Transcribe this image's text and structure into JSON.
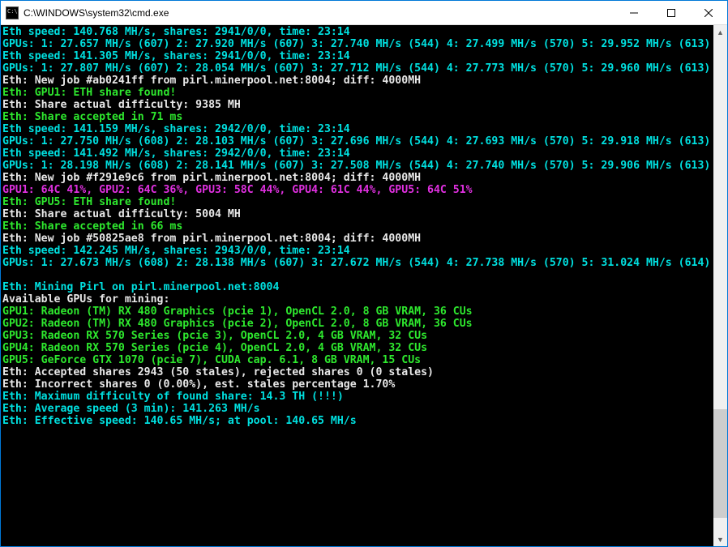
{
  "window": {
    "title": "C:\\WINDOWS\\system32\\cmd.exe"
  },
  "l": {
    "0": {
      "cls": "c-cyan",
      "t": "Eth speed: 140.768 MH/s, shares: 2941/0/0, time: 23:14"
    },
    "1": {
      "cls": "c-cyan",
      "t": "GPUs: 1: 27.657 MH/s (607) 2: 27.920 MH/s (607) 3: 27.740 MH/s (544) 4: 27.499 MH/s (570) 5: 29.952 MH/s (613)"
    },
    "2": {
      "cls": "c-cyan",
      "t": "Eth speed: 141.305 MH/s, shares: 2941/0/0, time: 23:14"
    },
    "3": {
      "cls": "c-cyan",
      "t": "GPUs: 1: 27.807 MH/s (607) 2: 28.054 MH/s (607) 3: 27.712 MH/s (544) 4: 27.773 MH/s (570) 5: 29.960 MH/s (613)"
    },
    "4": {
      "cls": "c-white",
      "t": "Eth: New job #ab0241ff from pirl.minerpool.net:8004; diff: 4000MH"
    },
    "5": {
      "cls": "c-green",
      "t": "Eth: GPU1: ETH share found!"
    },
    "6": {
      "cls": "c-white",
      "t": "Eth: Share actual difficulty: 9385 MH"
    },
    "7": {
      "cls": "c-green",
      "t": "Eth: Share accepted in 71 ms"
    },
    "8": {
      "cls": "c-cyan",
      "t": "Eth speed: 141.159 MH/s, shares: 2942/0/0, time: 23:14"
    },
    "9": {
      "cls": "c-cyan",
      "t": "GPUs: 1: 27.750 MH/s (608) 2: 28.103 MH/s (607) 3: 27.696 MH/s (544) 4: 27.693 MH/s (570) 5: 29.918 MH/s (613)"
    },
    "10": {
      "cls": "c-cyan",
      "t": "Eth speed: 141.492 MH/s, shares: 2942/0/0, time: 23:14"
    },
    "11": {
      "cls": "c-cyan",
      "t": "GPUs: 1: 28.198 MH/s (608) 2: 28.141 MH/s (607) 3: 27.508 MH/s (544) 4: 27.740 MH/s (570) 5: 29.906 MH/s (613)"
    },
    "12": {
      "cls": "c-white",
      "t": "Eth: New job #f291e9c6 from pirl.minerpool.net:8004; diff: 4000MH"
    },
    "13": {
      "cls": "c-mag",
      "t": "GPU1: 64C 41%, GPU2: 64C 36%, GPU3: 58C 44%, GPU4: 61C 44%, GPU5: 64C 51%"
    },
    "14": {
      "cls": "c-green",
      "t": "Eth: GPU5: ETH share found!"
    },
    "15": {
      "cls": "c-white",
      "t": "Eth: Share actual difficulty: 5004 MH"
    },
    "16": {
      "cls": "c-green",
      "t": "Eth: Share accepted in 66 ms"
    },
    "17": {
      "cls": "c-white",
      "t": "Eth: New job #50825ae8 from pirl.minerpool.net:8004; diff: 4000MH"
    },
    "18": {
      "cls": "c-cyan",
      "t": "Eth speed: 142.245 MH/s, shares: 2943/0/0, time: 23:14"
    },
    "19": {
      "cls": "c-cyan",
      "t": "GPUs: 1: 27.673 MH/s (608) 2: 28.138 MH/s (607) 3: 27.672 MH/s (544) 4: 27.738 MH/s (570) 5: 31.024 MH/s (614)"
    },
    "20": {
      "cls": "c-cyan",
      "t": ""
    },
    "21": {
      "cls": "c-cyan",
      "t": "Eth: Mining Pirl on pirl.minerpool.net:8004"
    },
    "22": {
      "cls": "c-white",
      "t": "Available GPUs for mining:"
    },
    "23": {
      "cls": "c-green",
      "t": "GPU1: Radeon (TM) RX 480 Graphics (pcie 1), OpenCL 2.0, 8 GB VRAM, 36 CUs"
    },
    "24": {
      "cls": "c-green",
      "t": "GPU2: Radeon (TM) RX 480 Graphics (pcie 2), OpenCL 2.0, 8 GB VRAM, 36 CUs"
    },
    "25": {
      "cls": "c-green",
      "t": "GPU3: Radeon RX 570 Series (pcie 3), OpenCL 2.0, 4 GB VRAM, 32 CUs"
    },
    "26": {
      "cls": "c-green",
      "t": "GPU4: Radeon RX 570 Series (pcie 4), OpenCL 2.0, 4 GB VRAM, 32 CUs"
    },
    "27": {
      "cls": "c-green",
      "t": "GPU5: GeForce GTX 1070 (pcie 7), CUDA cap. 6.1, 8 GB VRAM, 15 CUs"
    },
    "28": {
      "cls": "c-white",
      "t": "Eth: Accepted shares 2943 (50 stales), rejected shares 0 (0 stales)"
    },
    "29": {
      "cls": "c-white",
      "t": "Eth: Incorrect shares 0 (0.00%), est. stales percentage 1.70%"
    },
    "30": {
      "cls": "c-cyan",
      "t": "Eth: Maximum difficulty of found share: 14.3 TH (!!!)"
    },
    "31": {
      "cls": "c-cyan",
      "t": "Eth: Average speed (3 min): 141.263 MH/s"
    },
    "32": {
      "cls": "c-cyan",
      "t": "Eth: Effective speed: 140.65 MH/s; at pool: 140.65 MH/s"
    }
  }
}
